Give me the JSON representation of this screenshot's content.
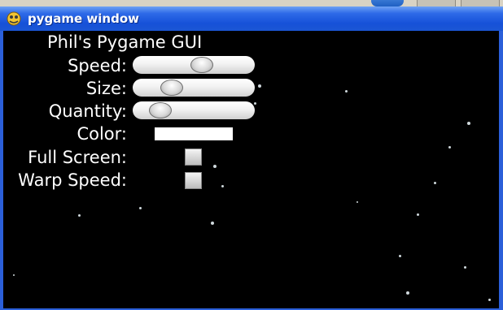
{
  "window": {
    "title": "pygame window",
    "icon": "pygame-snake-icon"
  },
  "gui": {
    "heading": "Phil's Pygame GUI",
    "controls": {
      "speed": {
        "label": "Speed:",
        "value": 0.58
      },
      "size": {
        "label": "Size:",
        "value": 0.28
      },
      "quantity": {
        "label": "Quantity:",
        "value": 0.16
      },
      "color": {
        "label": "Color:",
        "value": "#ffffff"
      },
      "fullscreen": {
        "label": "Full Screen:"
      },
      "warp_speed": {
        "label": "Warp Speed:"
      }
    }
  },
  "colors": {
    "titlebar": "#1651d8",
    "background": "#000000",
    "text": "#ffffff"
  }
}
